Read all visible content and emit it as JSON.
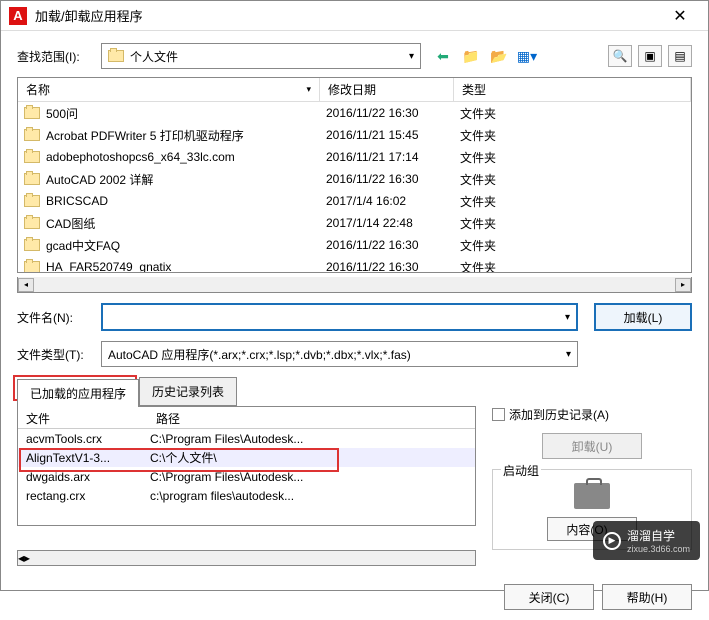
{
  "title": "加载/卸载应用程序",
  "labels": {
    "lookIn": "查找范围(I):",
    "fileName": "文件名(N):",
    "fileType": "文件类型(T):",
    "loadedTab": "已加载的应用程序",
    "historyTab": "历史记录列表",
    "addHistory": "添加到历史记录(A)",
    "unload": "卸载(U)",
    "startup": "启动组",
    "contents": "内容(O)...",
    "close": "关闭(C)",
    "help": "帮助(H)",
    "load": "加载(L)"
  },
  "location": "个人文件",
  "fileTypeValue": "AutoCAD 应用程序(*.arx;*.crx;*.lsp;*.dvb;*.dbx;*.vlx;*.fas)",
  "columns": {
    "name": "名称",
    "date": "修改日期",
    "type": "类型"
  },
  "files": [
    {
      "name": "500问",
      "date": "2016/11/22 16:30",
      "type": "文件夹"
    },
    {
      "name": "Acrobat PDFWriter 5 打印机驱动程序",
      "date": "2016/11/21 15:45",
      "type": "文件夹"
    },
    {
      "name": "adobephotoshopcs6_x64_33lc.com",
      "date": "2016/11/21 17:14",
      "type": "文件夹"
    },
    {
      "name": "AutoCAD 2002 详解",
      "date": "2016/11/22 16:30",
      "type": "文件夹"
    },
    {
      "name": "BRICSCAD",
      "date": "2017/1/4 16:02",
      "type": "文件夹"
    },
    {
      "name": "CAD图纸",
      "date": "2017/1/14 22:48",
      "type": "文件夹"
    },
    {
      "name": "gcad中文FAQ",
      "date": "2016/11/22 16:30",
      "type": "文件夹"
    },
    {
      "name": "HA_FAR520749_gnatix",
      "date": "2016/11/22 16:30",
      "type": "文件夹"
    }
  ],
  "loadedCols": {
    "file": "文件",
    "path": "路径"
  },
  "loaded": [
    {
      "file": "acvmTools.crx",
      "path": "C:\\Program Files\\Autodesk..."
    },
    {
      "file": "AlignTextV1-3...",
      "path": "C:\\个人文件\\"
    },
    {
      "file": "dwgaids.arx",
      "path": "C:\\Program Files\\Autodesk..."
    },
    {
      "file": "rectang.crx",
      "path": "c:\\program files\\autodesk..."
    }
  ],
  "watermark": {
    "brand": "溜溜自学",
    "url": "zixue.3d66.com"
  }
}
